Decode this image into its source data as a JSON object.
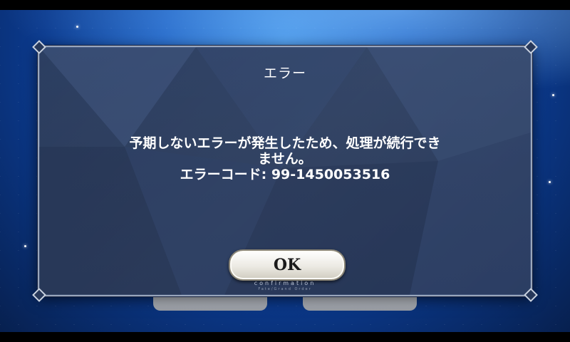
{
  "dialog": {
    "title": "エラー",
    "message_line1": "予期しないエラーが発生したため、処理が続行でき",
    "message_line2": "ません。",
    "message_line3": "エラーコード: 99-1450053516",
    "ok_label": "OK",
    "ok_sub1": "confirmation",
    "ok_sub2": "Fate/Grand Order"
  },
  "colors": {
    "dialog_bg": "#2a3b5c",
    "dialog_border": "#9aa7bd",
    "background_blue": "#1a5fc4"
  }
}
